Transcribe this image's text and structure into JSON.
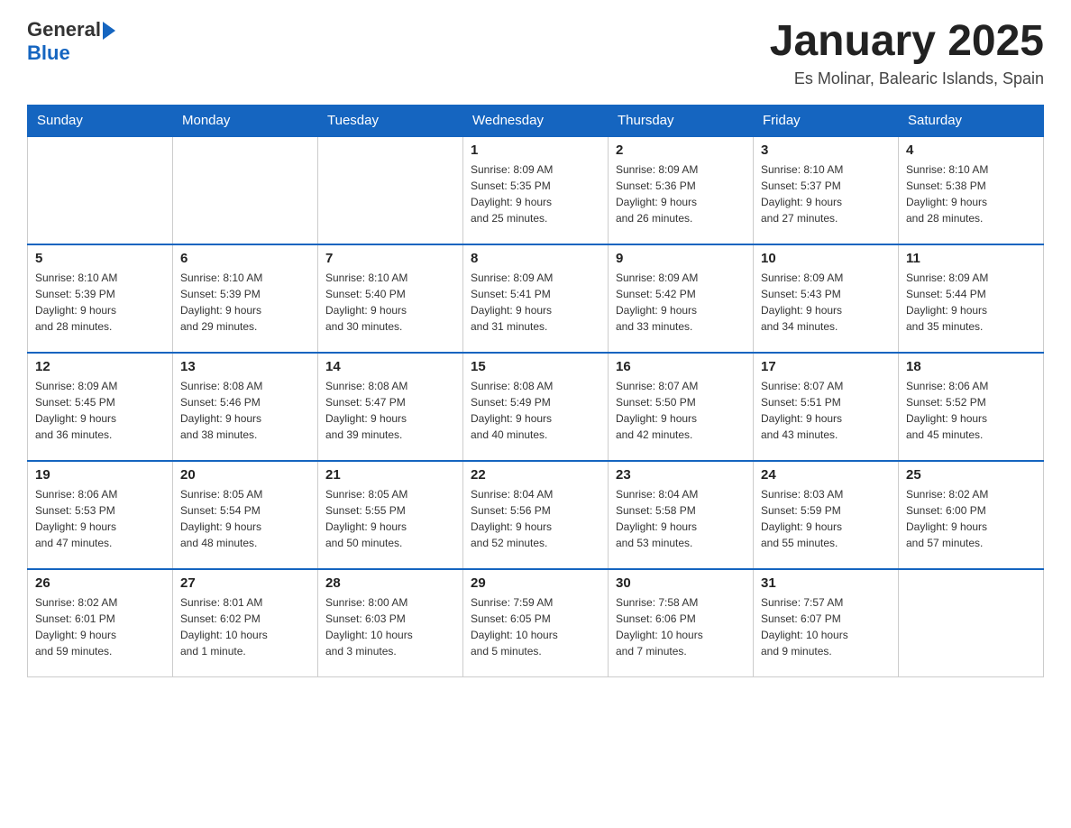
{
  "header": {
    "logo_text_general": "General",
    "logo_text_blue": "Blue",
    "title": "January 2025",
    "subtitle": "Es Molinar, Balearic Islands, Spain"
  },
  "calendar": {
    "days_of_week": [
      "Sunday",
      "Monday",
      "Tuesday",
      "Wednesday",
      "Thursday",
      "Friday",
      "Saturday"
    ],
    "weeks": [
      [
        {
          "day": "",
          "info": ""
        },
        {
          "day": "",
          "info": ""
        },
        {
          "day": "",
          "info": ""
        },
        {
          "day": "1",
          "info": "Sunrise: 8:09 AM\nSunset: 5:35 PM\nDaylight: 9 hours\nand 25 minutes."
        },
        {
          "day": "2",
          "info": "Sunrise: 8:09 AM\nSunset: 5:36 PM\nDaylight: 9 hours\nand 26 minutes."
        },
        {
          "day": "3",
          "info": "Sunrise: 8:10 AM\nSunset: 5:37 PM\nDaylight: 9 hours\nand 27 minutes."
        },
        {
          "day": "4",
          "info": "Sunrise: 8:10 AM\nSunset: 5:38 PM\nDaylight: 9 hours\nand 28 minutes."
        }
      ],
      [
        {
          "day": "5",
          "info": "Sunrise: 8:10 AM\nSunset: 5:39 PM\nDaylight: 9 hours\nand 28 minutes."
        },
        {
          "day": "6",
          "info": "Sunrise: 8:10 AM\nSunset: 5:39 PM\nDaylight: 9 hours\nand 29 minutes."
        },
        {
          "day": "7",
          "info": "Sunrise: 8:10 AM\nSunset: 5:40 PM\nDaylight: 9 hours\nand 30 minutes."
        },
        {
          "day": "8",
          "info": "Sunrise: 8:09 AM\nSunset: 5:41 PM\nDaylight: 9 hours\nand 31 minutes."
        },
        {
          "day": "9",
          "info": "Sunrise: 8:09 AM\nSunset: 5:42 PM\nDaylight: 9 hours\nand 33 minutes."
        },
        {
          "day": "10",
          "info": "Sunrise: 8:09 AM\nSunset: 5:43 PM\nDaylight: 9 hours\nand 34 minutes."
        },
        {
          "day": "11",
          "info": "Sunrise: 8:09 AM\nSunset: 5:44 PM\nDaylight: 9 hours\nand 35 minutes."
        }
      ],
      [
        {
          "day": "12",
          "info": "Sunrise: 8:09 AM\nSunset: 5:45 PM\nDaylight: 9 hours\nand 36 minutes."
        },
        {
          "day": "13",
          "info": "Sunrise: 8:08 AM\nSunset: 5:46 PM\nDaylight: 9 hours\nand 38 minutes."
        },
        {
          "day": "14",
          "info": "Sunrise: 8:08 AM\nSunset: 5:47 PM\nDaylight: 9 hours\nand 39 minutes."
        },
        {
          "day": "15",
          "info": "Sunrise: 8:08 AM\nSunset: 5:49 PM\nDaylight: 9 hours\nand 40 minutes."
        },
        {
          "day": "16",
          "info": "Sunrise: 8:07 AM\nSunset: 5:50 PM\nDaylight: 9 hours\nand 42 minutes."
        },
        {
          "day": "17",
          "info": "Sunrise: 8:07 AM\nSunset: 5:51 PM\nDaylight: 9 hours\nand 43 minutes."
        },
        {
          "day": "18",
          "info": "Sunrise: 8:06 AM\nSunset: 5:52 PM\nDaylight: 9 hours\nand 45 minutes."
        }
      ],
      [
        {
          "day": "19",
          "info": "Sunrise: 8:06 AM\nSunset: 5:53 PM\nDaylight: 9 hours\nand 47 minutes."
        },
        {
          "day": "20",
          "info": "Sunrise: 8:05 AM\nSunset: 5:54 PM\nDaylight: 9 hours\nand 48 minutes."
        },
        {
          "day": "21",
          "info": "Sunrise: 8:05 AM\nSunset: 5:55 PM\nDaylight: 9 hours\nand 50 minutes."
        },
        {
          "day": "22",
          "info": "Sunrise: 8:04 AM\nSunset: 5:56 PM\nDaylight: 9 hours\nand 52 minutes."
        },
        {
          "day": "23",
          "info": "Sunrise: 8:04 AM\nSunset: 5:58 PM\nDaylight: 9 hours\nand 53 minutes."
        },
        {
          "day": "24",
          "info": "Sunrise: 8:03 AM\nSunset: 5:59 PM\nDaylight: 9 hours\nand 55 minutes."
        },
        {
          "day": "25",
          "info": "Sunrise: 8:02 AM\nSunset: 6:00 PM\nDaylight: 9 hours\nand 57 minutes."
        }
      ],
      [
        {
          "day": "26",
          "info": "Sunrise: 8:02 AM\nSunset: 6:01 PM\nDaylight: 9 hours\nand 59 minutes."
        },
        {
          "day": "27",
          "info": "Sunrise: 8:01 AM\nSunset: 6:02 PM\nDaylight: 10 hours\nand 1 minute."
        },
        {
          "day": "28",
          "info": "Sunrise: 8:00 AM\nSunset: 6:03 PM\nDaylight: 10 hours\nand 3 minutes."
        },
        {
          "day": "29",
          "info": "Sunrise: 7:59 AM\nSunset: 6:05 PM\nDaylight: 10 hours\nand 5 minutes."
        },
        {
          "day": "30",
          "info": "Sunrise: 7:58 AM\nSunset: 6:06 PM\nDaylight: 10 hours\nand 7 minutes."
        },
        {
          "day": "31",
          "info": "Sunrise: 7:57 AM\nSunset: 6:07 PM\nDaylight: 10 hours\nand 9 minutes."
        },
        {
          "day": "",
          "info": ""
        }
      ]
    ]
  }
}
